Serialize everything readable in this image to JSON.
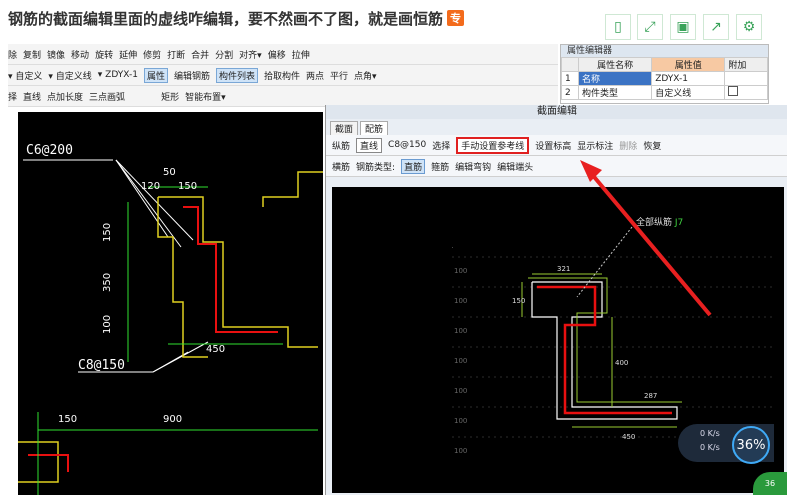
{
  "title": "钢筋的截面编辑里面的虚线咋编辑，要不然画不了图，就是画恒筋",
  "title_badge": "专",
  "toolbar1": {
    "items": [
      "除",
      "复制",
      "镜像",
      "移动",
      "旋转",
      "延伸",
      "修剪",
      "打断",
      "合并",
      "分割",
      "对齐▾",
      "偏移",
      "拉伸"
    ]
  },
  "toolbar2": {
    "items": [
      "▾ 自定义",
      "▾ 自定义线",
      "▾ ZDYX-1",
      "属性",
      "编辑钢筋",
      "构件列表",
      "拾取构件",
      "两点",
      "平行",
      "点角▾"
    ]
  },
  "toolbar3": {
    "items": [
      "择",
      "直线",
      "点加长度",
      "三点画弧",
      "矩形",
      "智能布置▾"
    ]
  },
  "prop_panel": {
    "title": "属性编辑器",
    "headers": [
      "属性名称",
      "属性值",
      "附加"
    ],
    "rows": [
      {
        "num": "1",
        "name": "名称",
        "value": "ZDYX-1"
      },
      {
        "num": "2",
        "name": "构件类型",
        "value": "自定义线"
      }
    ]
  },
  "cad_left": {
    "labels": {
      "spacing_top": "C6@200",
      "dim_50": "50",
      "dim_120": "120",
      "dim_150a": "150",
      "dim_v150": "150",
      "dim_v350": "350",
      "dim_v100": "100",
      "dim_450": "450",
      "spacing_bottom": "C8@150",
      "dim_150b": "150",
      "dim_900": "900"
    }
  },
  "section_editor": {
    "title": "截面编辑",
    "tabs": [
      "截面",
      "配筋"
    ],
    "row1": {
      "label": "纵筋",
      "mode": "直线",
      "spec": "C8@150",
      "select": "选择",
      "callout": "手动设置参考线",
      "set_elev": "设置标高",
      "show_note": "显示标注",
      "delete": "删除",
      "restore": "恢复"
    },
    "row2": {
      "horizontal": "横筋",
      "type_label": "钢筋类型:",
      "straight": "直筋",
      "stirrup": "箍筋",
      "edit_bend": "编辑弯钩",
      "edit_end": "编辑端头"
    },
    "canvas_label": "全部纵筋",
    "canvas_label_suffix": "J7",
    "dims": [
      "321",
      "150",
      "400",
      "287",
      "450"
    ],
    "grid_labels": [
      "100",
      "100",
      "100",
      "100",
      "100",
      "100",
      "100"
    ]
  },
  "speed": {
    "percent": "36%",
    "up": "0 K/s",
    "down": "0 K/s"
  },
  "corner_badge": "36"
}
